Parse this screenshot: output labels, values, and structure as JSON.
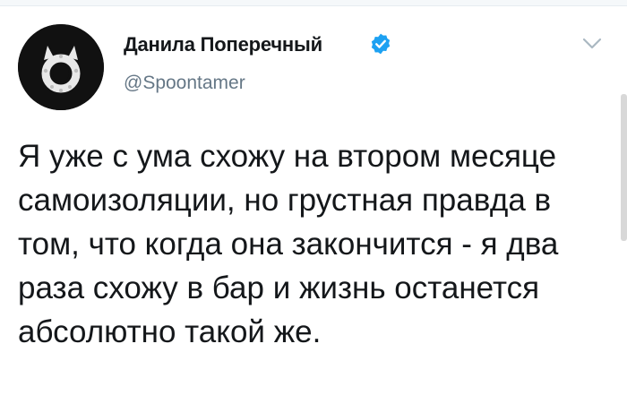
{
  "tweet": {
    "author_name": "Данила Поперечный",
    "author_handle": "@Spoontamer",
    "text": "Я уже с ума схожу на втором месяце самоизоляции, но грустная правда в том, что когда она закончится - я два раза схожу в бар и жизнь останется абсолютно такой же.",
    "verified": true
  },
  "icons": {
    "avatar": "owl-avatar",
    "verified": "verified-badge-icon",
    "menu": "chevron-down-icon"
  },
  "colors": {
    "verified_blue": "#1da1f2",
    "handle_gray": "#657786",
    "text": "#14171a"
  }
}
